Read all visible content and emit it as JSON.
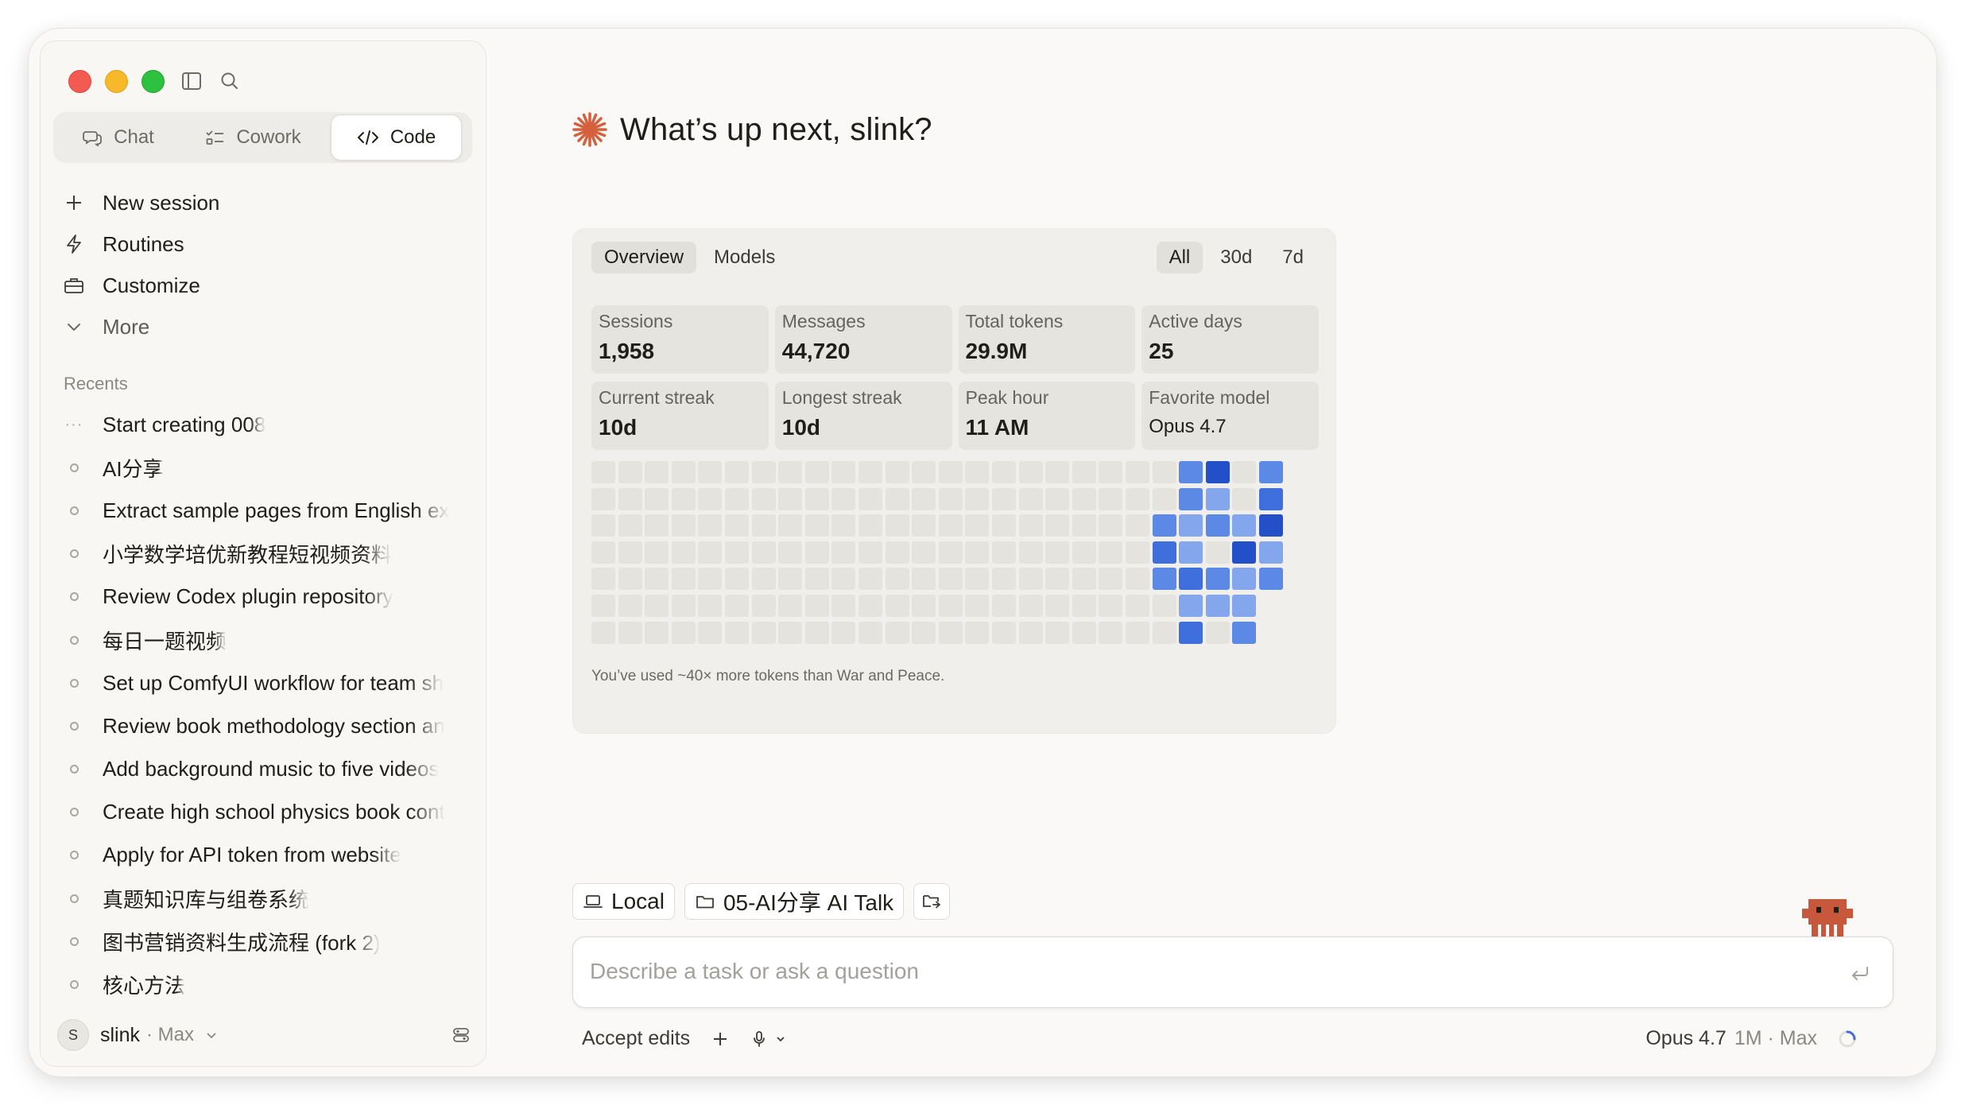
{
  "sidebar": {
    "modes": [
      {
        "label": "Chat",
        "icon": "chat-icon"
      },
      {
        "label": "Cowork",
        "icon": "checklist-icon"
      },
      {
        "label": "Code",
        "icon": "code-icon",
        "active": true
      }
    ],
    "nav": [
      {
        "label": "New session",
        "icon": "plus-icon"
      },
      {
        "label": "Routines",
        "icon": "bolt-icon"
      },
      {
        "label": "Customize",
        "icon": "briefcase-icon"
      },
      {
        "label": "More",
        "icon": "chevron-down-icon"
      }
    ],
    "recents_label": "Recents",
    "recents": [
      "Start creating 008",
      "AI分享",
      "Extract sample pages from English ex",
      "小学数学培优新教程短视频资料",
      "Review Codex plugin repository",
      "每日一题视频",
      "Set up ComfyUI workflow for team sh",
      "Review book methodology section an",
      "Add background music to five videos",
      "Create high school physics book cont",
      "Apply for API token from website",
      "真题知识库与组卷系统",
      "图书营销资料生成流程 (fork 2)",
      "核心方法"
    ],
    "user": {
      "initial": "S",
      "name": "slink",
      "plan": "· Max"
    }
  },
  "main": {
    "greeting": "What’s up next, slink?",
    "accent": "#d4603e",
    "stats": {
      "tabs": [
        "Overview",
        "Models"
      ],
      "ranges": [
        "All",
        "30d",
        "7d"
      ],
      "cards": [
        {
          "label": "Sessions",
          "value": "1,958"
        },
        {
          "label": "Messages",
          "value": "44,720"
        },
        {
          "label": "Total tokens",
          "value": "29.9M"
        },
        {
          "label": "Active days",
          "value": "25"
        },
        {
          "label": "Current streak",
          "value": "10d"
        },
        {
          "label": "Longest streak",
          "value": "10d"
        },
        {
          "label": "Peak hour",
          "value": "11 AM"
        },
        {
          "label": "Favorite model",
          "value": "Opus 4.7"
        }
      ],
      "heatmap_levels": [
        [
          0,
          0,
          0,
          0,
          0,
          0,
          0,
          0,
          0,
          0,
          0,
          0,
          0,
          0,
          0,
          0,
          0,
          0,
          0,
          0,
          0,
          0,
          2,
          4,
          0,
          2
        ],
        [
          0,
          0,
          0,
          0,
          0,
          0,
          0,
          0,
          0,
          0,
          0,
          0,
          0,
          0,
          0,
          0,
          0,
          0,
          0,
          0,
          0,
          0,
          2,
          1,
          0,
          3
        ],
        [
          0,
          0,
          0,
          0,
          0,
          0,
          0,
          0,
          0,
          0,
          0,
          0,
          0,
          0,
          0,
          0,
          0,
          0,
          0,
          0,
          0,
          2,
          1,
          2,
          1,
          4
        ],
        [
          0,
          0,
          0,
          0,
          0,
          0,
          0,
          0,
          0,
          0,
          0,
          0,
          0,
          0,
          0,
          0,
          0,
          0,
          0,
          0,
          0,
          3,
          1,
          0,
          4,
          1
        ],
        [
          0,
          0,
          0,
          0,
          0,
          0,
          0,
          0,
          0,
          0,
          0,
          0,
          0,
          0,
          0,
          0,
          0,
          0,
          0,
          0,
          0,
          2,
          3,
          2,
          1,
          2
        ],
        [
          0,
          0,
          0,
          0,
          0,
          0,
          0,
          0,
          0,
          0,
          0,
          0,
          0,
          0,
          0,
          0,
          0,
          0,
          0,
          0,
          0,
          0,
          1,
          1,
          1,
          -1
        ],
        [
          0,
          0,
          0,
          0,
          0,
          0,
          0,
          0,
          0,
          0,
          0,
          0,
          0,
          0,
          0,
          0,
          0,
          0,
          0,
          0,
          0,
          0,
          3,
          0,
          2,
          -1
        ]
      ],
      "heat_colors": [
        "#e5e3de",
        "#83a6ec",
        "#5c88e6",
        "#3e6fdd",
        "#2350c9"
      ],
      "footnote": "You’ve used ~40× more tokens than War and Peace."
    },
    "chips": [
      {
        "label": "Local",
        "icon": "laptop-icon"
      },
      {
        "label": "05-AI分享 AI Talk",
        "icon": "folder-icon"
      }
    ],
    "input_placeholder": "Describe a task or ask a question",
    "accept_label": "Accept edits",
    "model": "Opus 4.7",
    "model_meta": "1M · Max"
  }
}
